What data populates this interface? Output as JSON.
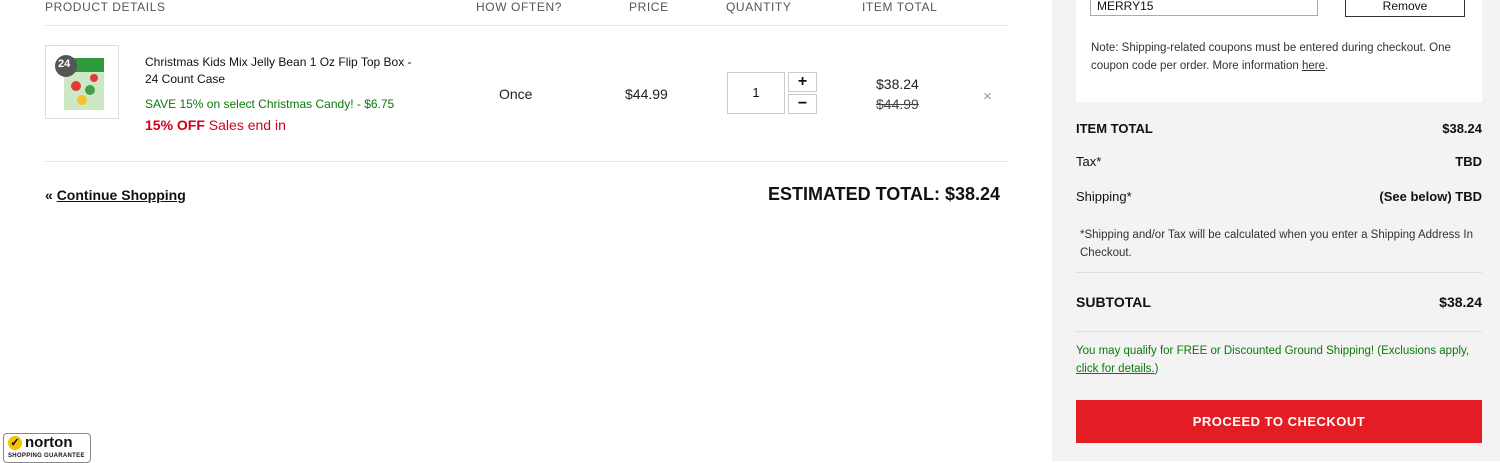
{
  "table_headers": {
    "product": "PRODUCT DETAILS",
    "frequency": "HOW OFTEN?",
    "price": "PRICE",
    "quantity": "QUANTITY",
    "item_total": "ITEM TOTAL"
  },
  "cart_item": {
    "thumb_badge": "24",
    "name": "Christmas Kids Mix Jelly Bean 1 Oz Flip Top Box - 24 Count Case",
    "promo": "SAVE 15% on select Christmas Candy! - $6.75",
    "sale_pct": "15% OFF",
    "sale_text": "Sales end in",
    "frequency": "Once",
    "price": "$44.99",
    "quantity": "1",
    "total": "$38.24",
    "original_total": "$44.99",
    "remove_glyph": "×"
  },
  "footer": {
    "continue_icon": "«",
    "continue_label": "Continue Shopping",
    "estimated_total": "ESTIMATED TOTAL: $38.24"
  },
  "sidebar": {
    "coupon_value": "MERRY15",
    "remove_label": "Remove",
    "note": "Note: Shipping-related coupons must be entered during checkout. One coupon code per order. More information",
    "note_link": "here",
    "rows": [
      {
        "label": "ITEM TOTAL",
        "value": "$38.24"
      },
      {
        "label": "Tax*",
        "value": "TBD"
      },
      {
        "label": "Shipping*",
        "value": "(See below) TBD"
      }
    ],
    "ship_note": "*Shipping and/or Tax will be calculated when you enter a Shipping Address In Checkout.",
    "subtotal_label": "SUBTOTAL",
    "subtotal_value": "$38.24",
    "qualify_text": "You may qualify for FREE or Discounted Ground Shipping! (Exclusions apply,",
    "qualify_link": "click for details.",
    "qualify_end": ")",
    "checkout_label": "PROCEED TO CHECKOUT"
  },
  "badge": {
    "brand": "norton",
    "sub": "SHOPPING GUARANTEE"
  },
  "colors": {
    "accent_red": "#e41c23",
    "promo_green": "#0a7a0a",
    "sale_red": "#d0021b"
  }
}
